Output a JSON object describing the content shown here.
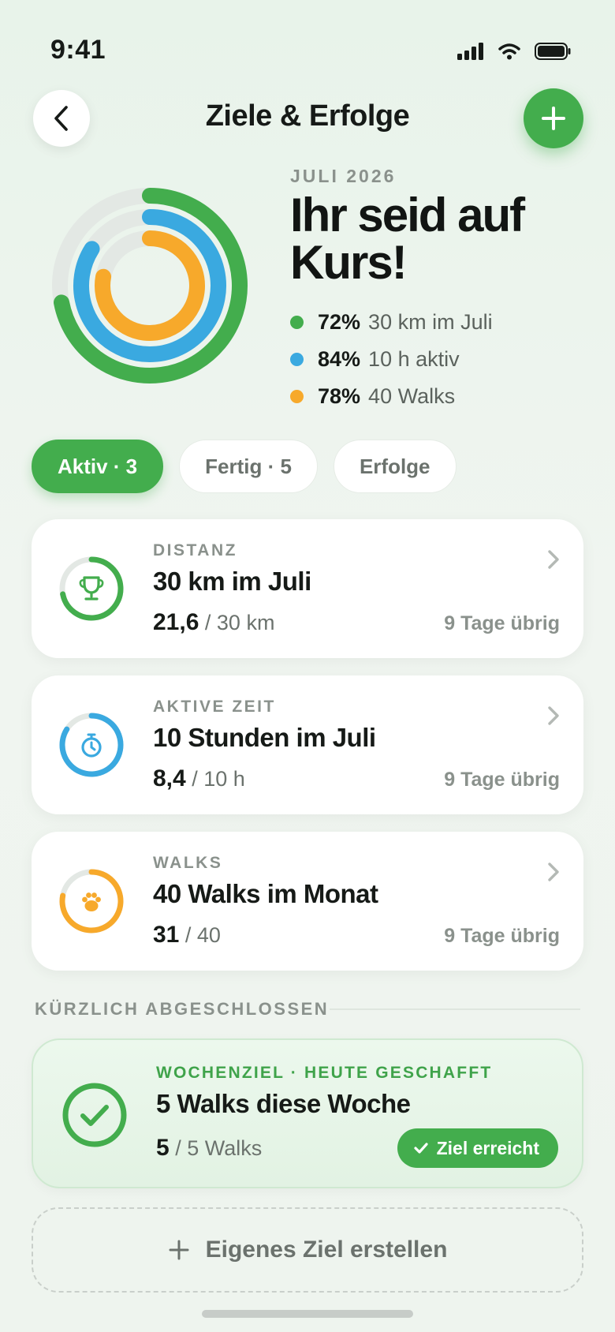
{
  "status_bar": {
    "time": "9:41"
  },
  "header": {
    "title": "Ziele & Erfolge"
  },
  "hero": {
    "month": "JULI 2026",
    "headline_line1": "Ihr seid auf",
    "headline_line2": "Kurs!",
    "legend": [
      {
        "pct": "72%",
        "label": "30 km im Juli",
        "color": "#43ad4d",
        "fraction": 0.72
      },
      {
        "pct": "84%",
        "label": "10 h aktiv",
        "color": "#3aa9e0",
        "fraction": 0.84
      },
      {
        "pct": "78%",
        "label": "40 Walks",
        "color": "#f7a92b",
        "fraction": 0.78
      }
    ]
  },
  "tabs": [
    {
      "label": "Aktiv · 3",
      "active": true
    },
    {
      "label": "Fertig · 5",
      "active": false
    },
    {
      "label": "Erfolge",
      "active": false
    }
  ],
  "goals": [
    {
      "kicker": "DISTANZ",
      "title": "30 km im Juli",
      "current": "21,6",
      "target": "/ 30 km",
      "remaining": "9 Tage übrig",
      "icon": "trophy-icon",
      "color": "#43ad4d",
      "fraction": 0.72
    },
    {
      "kicker": "AKTIVE ZEIT",
      "title": "10 Stunden im Juli",
      "current": "8,4",
      "target": "/ 10 h",
      "remaining": "9 Tage übrig",
      "icon": "stopwatch-icon",
      "color": "#3aa9e0",
      "fraction": 0.84
    },
    {
      "kicker": "WALKS",
      "title": "40 Walks im Monat",
      "current": "31",
      "target": "/ 40",
      "remaining": "9 Tage übrig",
      "icon": "paw-icon",
      "color": "#f7a92b",
      "fraction": 0.78
    }
  ],
  "recent": {
    "section_label": "KÜRZLICH ABGESCHLOSSEN",
    "kicker": "WOCHENZIEL · HEUTE GESCHAFFT",
    "title": "5 Walks diese Woche",
    "current": "5",
    "target": "/ 5 Walks",
    "badge": "Ziel erreicht"
  },
  "create": {
    "label": "Eigenes Ziel erstellen"
  }
}
